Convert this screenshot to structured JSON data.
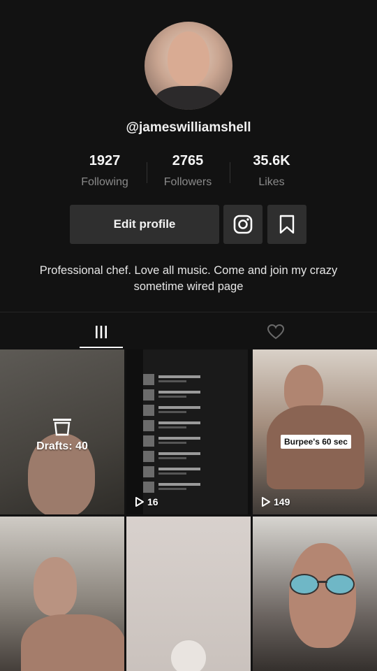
{
  "profile": {
    "username": "@jameswilliamshell",
    "bio": "Professional chef.  Love all music. Come and join my crazy sometime wired page"
  },
  "stats": [
    {
      "value": "1927",
      "label": "Following"
    },
    {
      "value": "2765",
      "label": "Followers"
    },
    {
      "value": "35.6K",
      "label": "Likes"
    }
  ],
  "actions": {
    "edit_label": "Edit profile",
    "instagram_icon": "instagram-icon",
    "bookmark_icon": "bookmark-icon"
  },
  "tabs": [
    {
      "icon": "grid-icon",
      "active": true
    },
    {
      "icon": "heart-icon",
      "active": false
    }
  ],
  "grid": [
    {
      "type": "drafts",
      "label": "Drafts: 40"
    },
    {
      "type": "video",
      "views": "16"
    },
    {
      "type": "video",
      "views": "149",
      "sticker": "Burpee's 60 sec"
    },
    {
      "type": "video"
    },
    {
      "type": "video"
    },
    {
      "type": "video"
    }
  ],
  "colors": {
    "background": "#121212",
    "button": "#2f2f2f",
    "muted_text": "#8a8a8a"
  }
}
